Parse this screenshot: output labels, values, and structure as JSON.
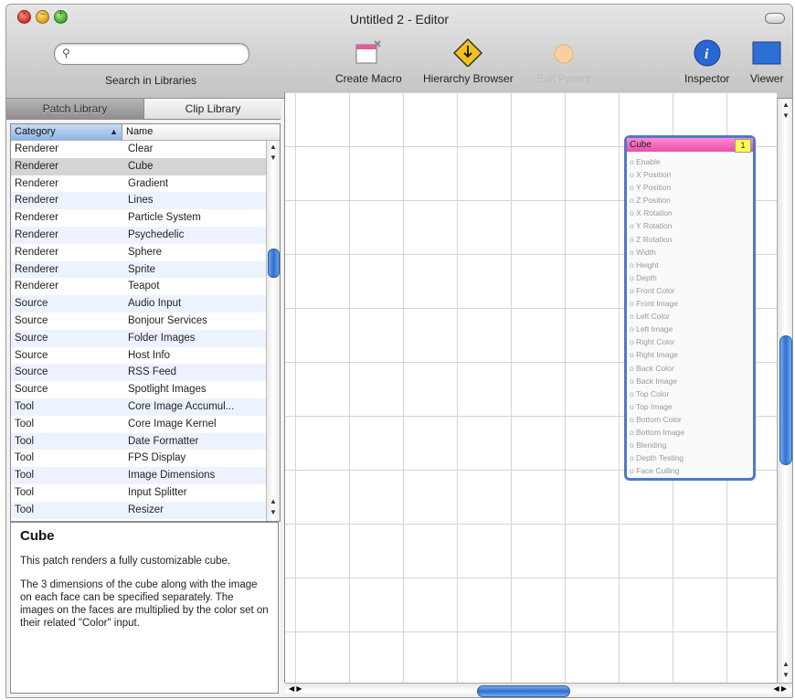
{
  "window": {
    "title": "Untitled 2 - Editor"
  },
  "toolbar": {
    "search_label": "Search in Libraries",
    "create_macro": "Create Macro",
    "hierarchy_browser": "Hierarchy Browser",
    "edit_parent": "Edit Parent",
    "inspector": "Inspector",
    "viewer": "Viewer"
  },
  "library_tabs": {
    "patch_library": "Patch Library",
    "clip_library": "Clip Library"
  },
  "table": {
    "headers": {
      "category": "Category",
      "name": "Name"
    },
    "rows": [
      {
        "category": "Renderer",
        "name": "Clear"
      },
      {
        "category": "Renderer",
        "name": "Cube"
      },
      {
        "category": "Renderer",
        "name": "Gradient"
      },
      {
        "category": "Renderer",
        "name": "Lines"
      },
      {
        "category": "Renderer",
        "name": "Particle System"
      },
      {
        "category": "Renderer",
        "name": "Psychedelic"
      },
      {
        "category": "Renderer",
        "name": "Sphere"
      },
      {
        "category": "Renderer",
        "name": "Sprite"
      },
      {
        "category": "Renderer",
        "name": "Teapot"
      },
      {
        "category": "Source",
        "name": "Audio Input"
      },
      {
        "category": "Source",
        "name": "Bonjour Services"
      },
      {
        "category": "Source",
        "name": "Folder Images"
      },
      {
        "category": "Source",
        "name": "Host Info"
      },
      {
        "category": "Source",
        "name": "RSS Feed"
      },
      {
        "category": "Source",
        "name": "Spotlight Images"
      },
      {
        "category": "Tool",
        "name": "Core Image Accumul..."
      },
      {
        "category": "Tool",
        "name": "Core Image Kernel"
      },
      {
        "category": "Tool",
        "name": "Date Formatter"
      },
      {
        "category": "Tool",
        "name": "FPS Display"
      },
      {
        "category": "Tool",
        "name": "Image Dimensions"
      },
      {
        "category": "Tool",
        "name": "Input Splitter"
      },
      {
        "category": "Tool",
        "name": "Resizer"
      }
    ]
  },
  "description": {
    "title": "Cube",
    "p1": "This patch renders a fully customizable cube.",
    "p2": "The 3 dimensions of the cube along with the image on each face can be specified separately. The images on the faces are multiplied by the color set on their related \"Color\" input."
  },
  "patch": {
    "title": "Cube",
    "badge": "1",
    "ports": [
      "Enable",
      "X Position",
      "Y Position",
      "Z Position",
      "X Rotation",
      "Y Rotation",
      "Z Rotation",
      "Width",
      "Height",
      "Depth",
      "Front Color",
      "Front Image",
      "Left Color",
      "Left Image",
      "Right Color",
      "Right Image",
      "Back Color",
      "Back Image",
      "Top Color",
      "Top Image",
      "Bottom Color",
      "Bottom Image",
      "Blending",
      "Depth Testing",
      "Face Culling"
    ]
  },
  "colors": {
    "selection": "#d4d4d4",
    "patch_header": "#ff6fc8",
    "accent_blue": "#2f6fce"
  }
}
